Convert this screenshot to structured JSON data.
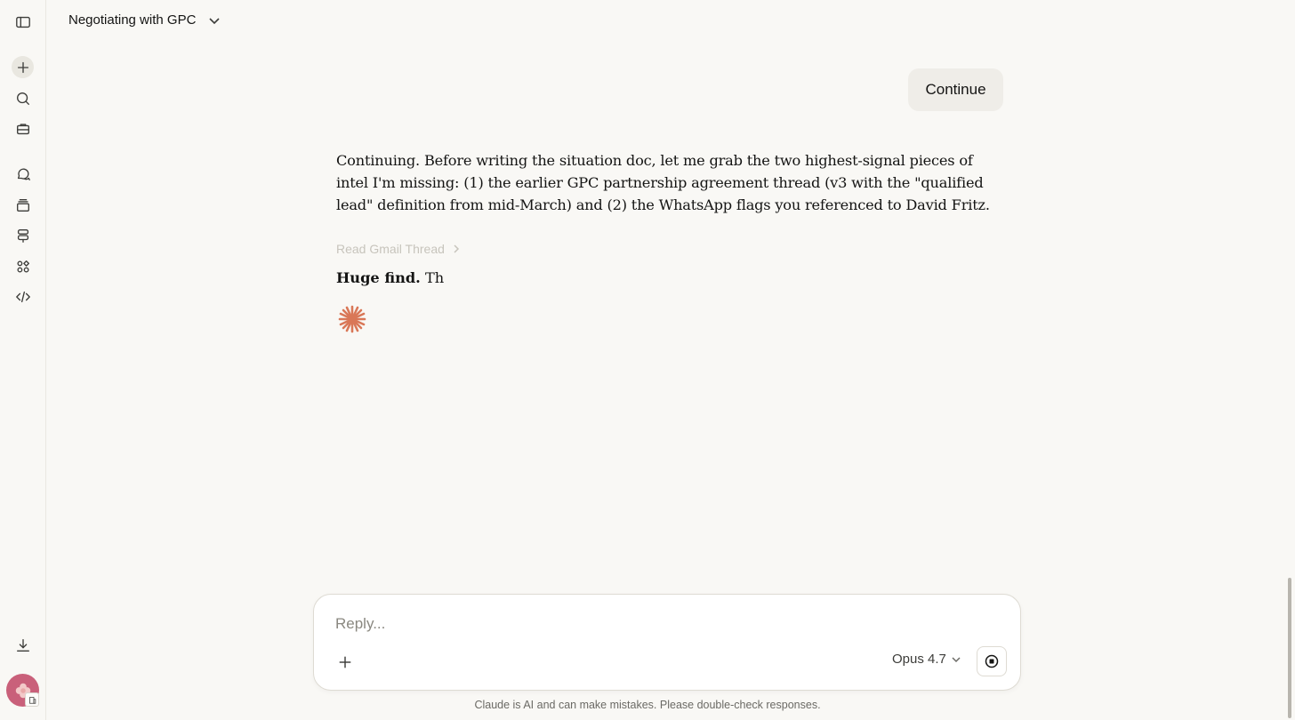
{
  "sidebar": {
    "items": [
      {
        "icon": "sidebar-toggle-icon"
      },
      {
        "icon": "plus-icon"
      },
      {
        "icon": "search-icon"
      },
      {
        "icon": "briefcase-icon"
      },
      {
        "icon": "chats-icon"
      },
      {
        "icon": "projects-icon"
      },
      {
        "icon": "signpost-icon"
      },
      {
        "icon": "artifacts-icon"
      },
      {
        "icon": "code-icon"
      },
      {
        "icon": "download-icon"
      }
    ]
  },
  "header": {
    "title": "Negotiating with GPC"
  },
  "conversation": {
    "user_message": "Continue",
    "assistant_text": "Continuing. Before writing the situation doc, let me grab the two highest-signal pieces of intel I'm missing: (1) the earlier GPC partnership agreement thread (v3 with the \"qualified lead\" definition from mid-March) and (2) the WhatsApp flags you referenced to David Fritz.",
    "tool_call_label": "Read Gmail Thread",
    "partial_bold": "Huge find.",
    "partial_rest": " Th"
  },
  "composer": {
    "placeholder": "Reply...",
    "model": "Opus 4.7"
  },
  "footer": {
    "disclaimer": "Claude is AI and can make mistakes. Please double-check responses."
  },
  "colors": {
    "accent": "#d97757",
    "background": "#f9f8f5"
  }
}
